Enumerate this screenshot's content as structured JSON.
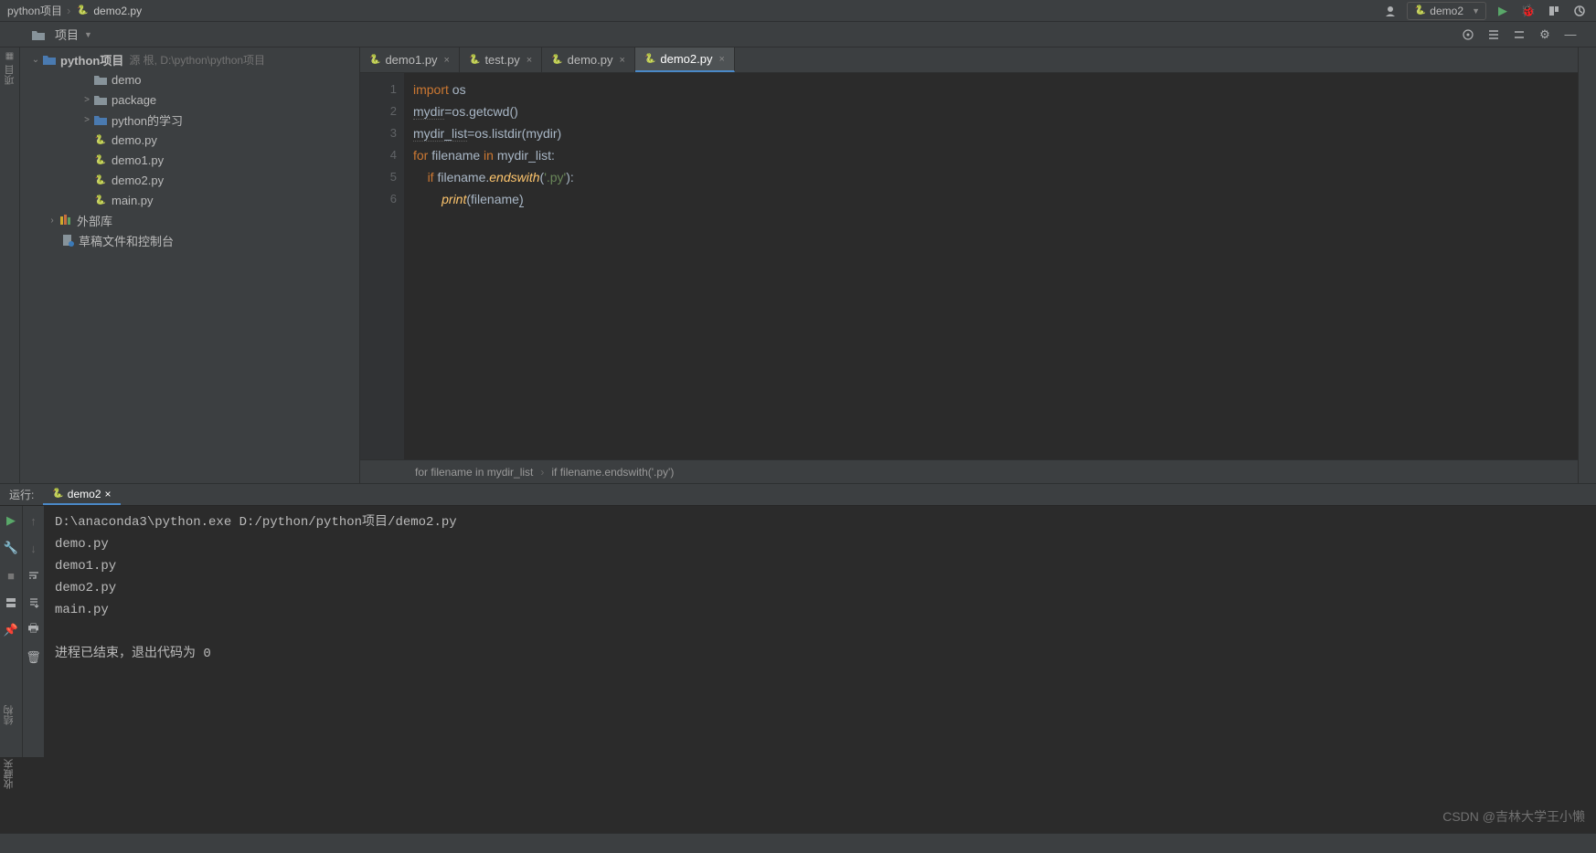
{
  "breadcrumb": {
    "project": "python项目",
    "file": "demo2.py",
    "icon": "python项目"
  },
  "run_config": "demo2",
  "project_panel": {
    "title": "项目",
    "root_name": "python项目",
    "root_hint": "源 根, D:\\python\\python项目",
    "items": [
      {
        "label": "demo",
        "type": "folder",
        "level": 2
      },
      {
        "label": "package",
        "type": "folder",
        "level": 2,
        "expander": ">"
      },
      {
        "label": "python的学习",
        "type": "folder-blue",
        "level": 2,
        "expander": ">"
      },
      {
        "label": "demo.py",
        "type": "py",
        "level": 2
      },
      {
        "label": "demo1.py",
        "type": "py",
        "level": 2
      },
      {
        "label": "demo2.py",
        "type": "py",
        "level": 2
      },
      {
        "label": "main.py",
        "type": "py",
        "level": 2
      }
    ],
    "ext_lib": "外部库",
    "scratch": "草稿文件和控制台"
  },
  "tabs": [
    {
      "label": "demo1.py",
      "active": false
    },
    {
      "label": "test.py",
      "active": false
    },
    {
      "label": "demo.py",
      "active": false
    },
    {
      "label": "demo2.py",
      "active": true
    }
  ],
  "code": {
    "lines": [
      {
        "n": "1",
        "html": "<span class='kw'>import</span> <span class='id'>os</span>"
      },
      {
        "n": "2",
        "html": "<span class='id und'>mydir</span><span class='id'>=os.getcwd()</span>"
      },
      {
        "n": "3",
        "html": "<span class='id und'>mydir_list</span><span class='id'>=os.listdir(</span><span class='id'>mydir</span><span class='id'>)</span>"
      },
      {
        "n": "4",
        "html": "<span class='kw'>for</span> <span class='id'>filename</span> <span class='kw'>in</span> <span class='id'>mydir_list:</span>"
      },
      {
        "n": "5",
        "html": "    <span class='kw'>if</span> <span class='id'>filename.</span><span class='fn'>endswith</span><span class='paren'>(</span><span class='str'>'.py'</span><span class='paren'>):</span>",
        "bulb": true
      },
      {
        "n": "6",
        "html": "        <span class='fn'>print</span><span class='paren'>(</span><span class='id'>filename</span><span class='paren ucursor'>)</span>"
      }
    ]
  },
  "crumb_bar": {
    "left": "for filename in mydir_list",
    "right": "if filename.endswith('.py')"
  },
  "run": {
    "label": "运行:",
    "tab": "demo2",
    "output": "D:\\anaconda3\\python.exe D:/python/python项目/demo2.py\ndemo.py\ndemo1.py\ndemo2.py\nmain.py\n\n进程已结束，退出代码为 0"
  },
  "left_gutter_label": "项目",
  "watermark": "CSDN @吉林大学王小懒"
}
